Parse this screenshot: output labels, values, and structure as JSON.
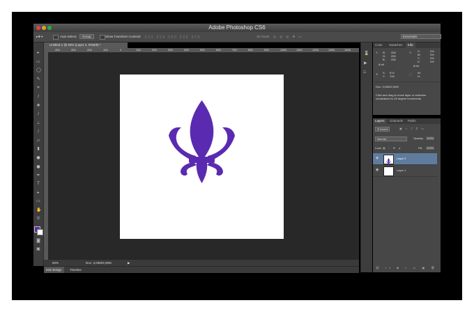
{
  "app": {
    "title": "Adobe Photoshop CS6"
  },
  "options_bar": {
    "auto_select_label": "Auto-Select:",
    "auto_select_value": "Group",
    "transform_label": "Show Transform Controls",
    "mode_3d": "3D Mode:",
    "workspace": "Essentials"
  },
  "document": {
    "tab_title": "Untitled-1 @ 50% (Layer 2, RGB/8) *",
    "ruler_ticks": [
      "400",
      "300",
      "200",
      "100",
      "0",
      "100",
      "200",
      "300",
      "400",
      "500",
      "600",
      "700",
      "800",
      "900",
      "1000",
      "1100",
      "1200",
      "1300",
      "1400"
    ],
    "zoom": "50%",
    "doc_size": "Doc: 3,00M/2,00M"
  },
  "bottom_tabs": [
    "Mini Bridge",
    "Timeline"
  ],
  "info_panel": {
    "tabs": [
      "Color",
      "Swatches",
      "Info"
    ],
    "r": "R:",
    "r_val": "255",
    "g": "G:",
    "g_val": "255",
    "b": "B:",
    "b_val": "255",
    "c": "C:",
    "c_val": "0%",
    "m": "M:",
    "m_val": "0%",
    "y": "Y:",
    "y_val": "0%",
    "k": "K:",
    "k_val": "0%",
    "bit1": "8-bit",
    "bit2": "8-bit",
    "x": "X:",
    "x_val": "674",
    "y2": "Y:",
    "y2_val": "726",
    "w": "W:",
    "h": "H:",
    "doc": "Doc: 3,00M/2,00M",
    "hint": "Click and drag to move layer or selection constrained to 45 degree increments."
  },
  "layers_panel": {
    "tabs": [
      "Layers",
      "Channels",
      "Paths"
    ],
    "kind": "Kind",
    "blend": "Normal",
    "opacity_label": "Opacity:",
    "opacity": "100%",
    "lock_label": "Lock:",
    "fill_label": "Fill:",
    "fill": "100%",
    "layers": [
      {
        "name": "Layer 2",
        "selected": true
      },
      {
        "name": "Layer 1",
        "selected": false
      }
    ]
  },
  "colors": {
    "fleur": "#5a2bb0",
    "foreground": "#5a2bb0",
    "selected_layer": "#5f7c9e"
  }
}
